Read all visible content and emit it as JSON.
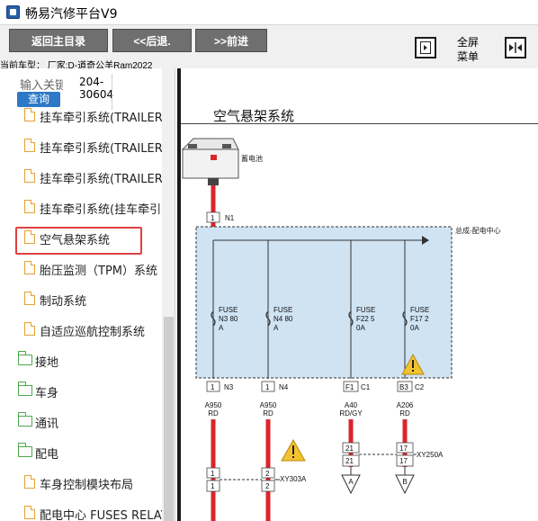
{
  "app": {
    "title": "畅易汽修平台V9",
    "icon": "app-logo-icon"
  },
  "toolbar": {
    "back_main": "返回主目录",
    "back": "<<后退.",
    "forward": ">>前进",
    "fullscreen_line1": "全屏",
    "fullscreen_line2": "菜单",
    "left_square_icon": "collapse-panel-icon",
    "right_square_icon": "expand-panel-icon"
  },
  "vehicle": {
    "text": "当前车型： 厂家:D-道奇公羊Ram2022"
  },
  "search": {
    "label": "输入关键",
    "button": "查询",
    "code_line1": "204-",
    "code_line2": "30604"
  },
  "tree": {
    "items": [
      {
        "label": "挂车牵引系统(TRAILER",
        "icon": "document-icon"
      },
      {
        "label": "挂车牵引系统(TRAILER",
        "icon": "document-icon"
      },
      {
        "label": "挂车牵引系统(TRAILER",
        "icon": "document-icon"
      },
      {
        "label": "挂车牵引系统(挂车牵引",
        "icon": "document-icon"
      },
      {
        "label": "空气悬架系统",
        "icon": "document-icon",
        "selected": true
      },
      {
        "label": "胎压监测（TPM）系统",
        "icon": "document-icon"
      },
      {
        "label": "制动系统",
        "icon": "document-icon"
      },
      {
        "label": "自适应巡航控制系统",
        "icon": "document-icon"
      },
      {
        "label": "接地",
        "icon": "folder-icon"
      },
      {
        "label": "车身",
        "icon": "folder-icon"
      },
      {
        "label": "通讯",
        "icon": "folder-icon"
      },
      {
        "label": "配电",
        "icon": "folder-open-icon"
      },
      {
        "label": "车身控制模块布局",
        "icon": "document-icon"
      },
      {
        "label": "配电中心 FUSES RELAY",
        "icon": "document-icon"
      }
    ]
  },
  "diagram": {
    "title": "空气悬架系统",
    "battery_label": "蓄电池",
    "pdc_label": "总成-配电中心",
    "battery_pin": {
      "pin": "1",
      "name": "N1"
    },
    "fuses": [
      {
        "l1": "FUSE",
        "l2": "N3 80",
        "l3": "A"
      },
      {
        "l1": "FUSE",
        "l2": "N4 80",
        "l3": "A"
      },
      {
        "l1": "FUSE",
        "l2": "F22 5",
        "l3": "0A"
      },
      {
        "l1": "FUSE",
        "l2": "F17 2",
        "l3": "0A"
      }
    ],
    "out_pins": [
      {
        "pin": "1",
        "name": "N3",
        "wire": "A950",
        "color": "RD"
      },
      {
        "pin": "1",
        "name": "N4",
        "wire": "A950",
        "color": "RD"
      },
      {
        "pin": "F1",
        "name": "C1",
        "wire": "A40",
        "color": "RD/GY"
      },
      {
        "pin": "B3",
        "name": "C2",
        "wire": "A206",
        "color": "RD"
      }
    ],
    "connector_left": {
      "p1": "1",
      "p2": "2",
      "name": "XY303A"
    },
    "connector_right": {
      "p1": "21",
      "p2": "17",
      "name": "XY250A"
    },
    "refs": [
      "A",
      "B"
    ],
    "colors": {
      "wire_red": "#d9262c",
      "box_fill": "#cfe3f3",
      "warning": "#f2c230"
    }
  }
}
